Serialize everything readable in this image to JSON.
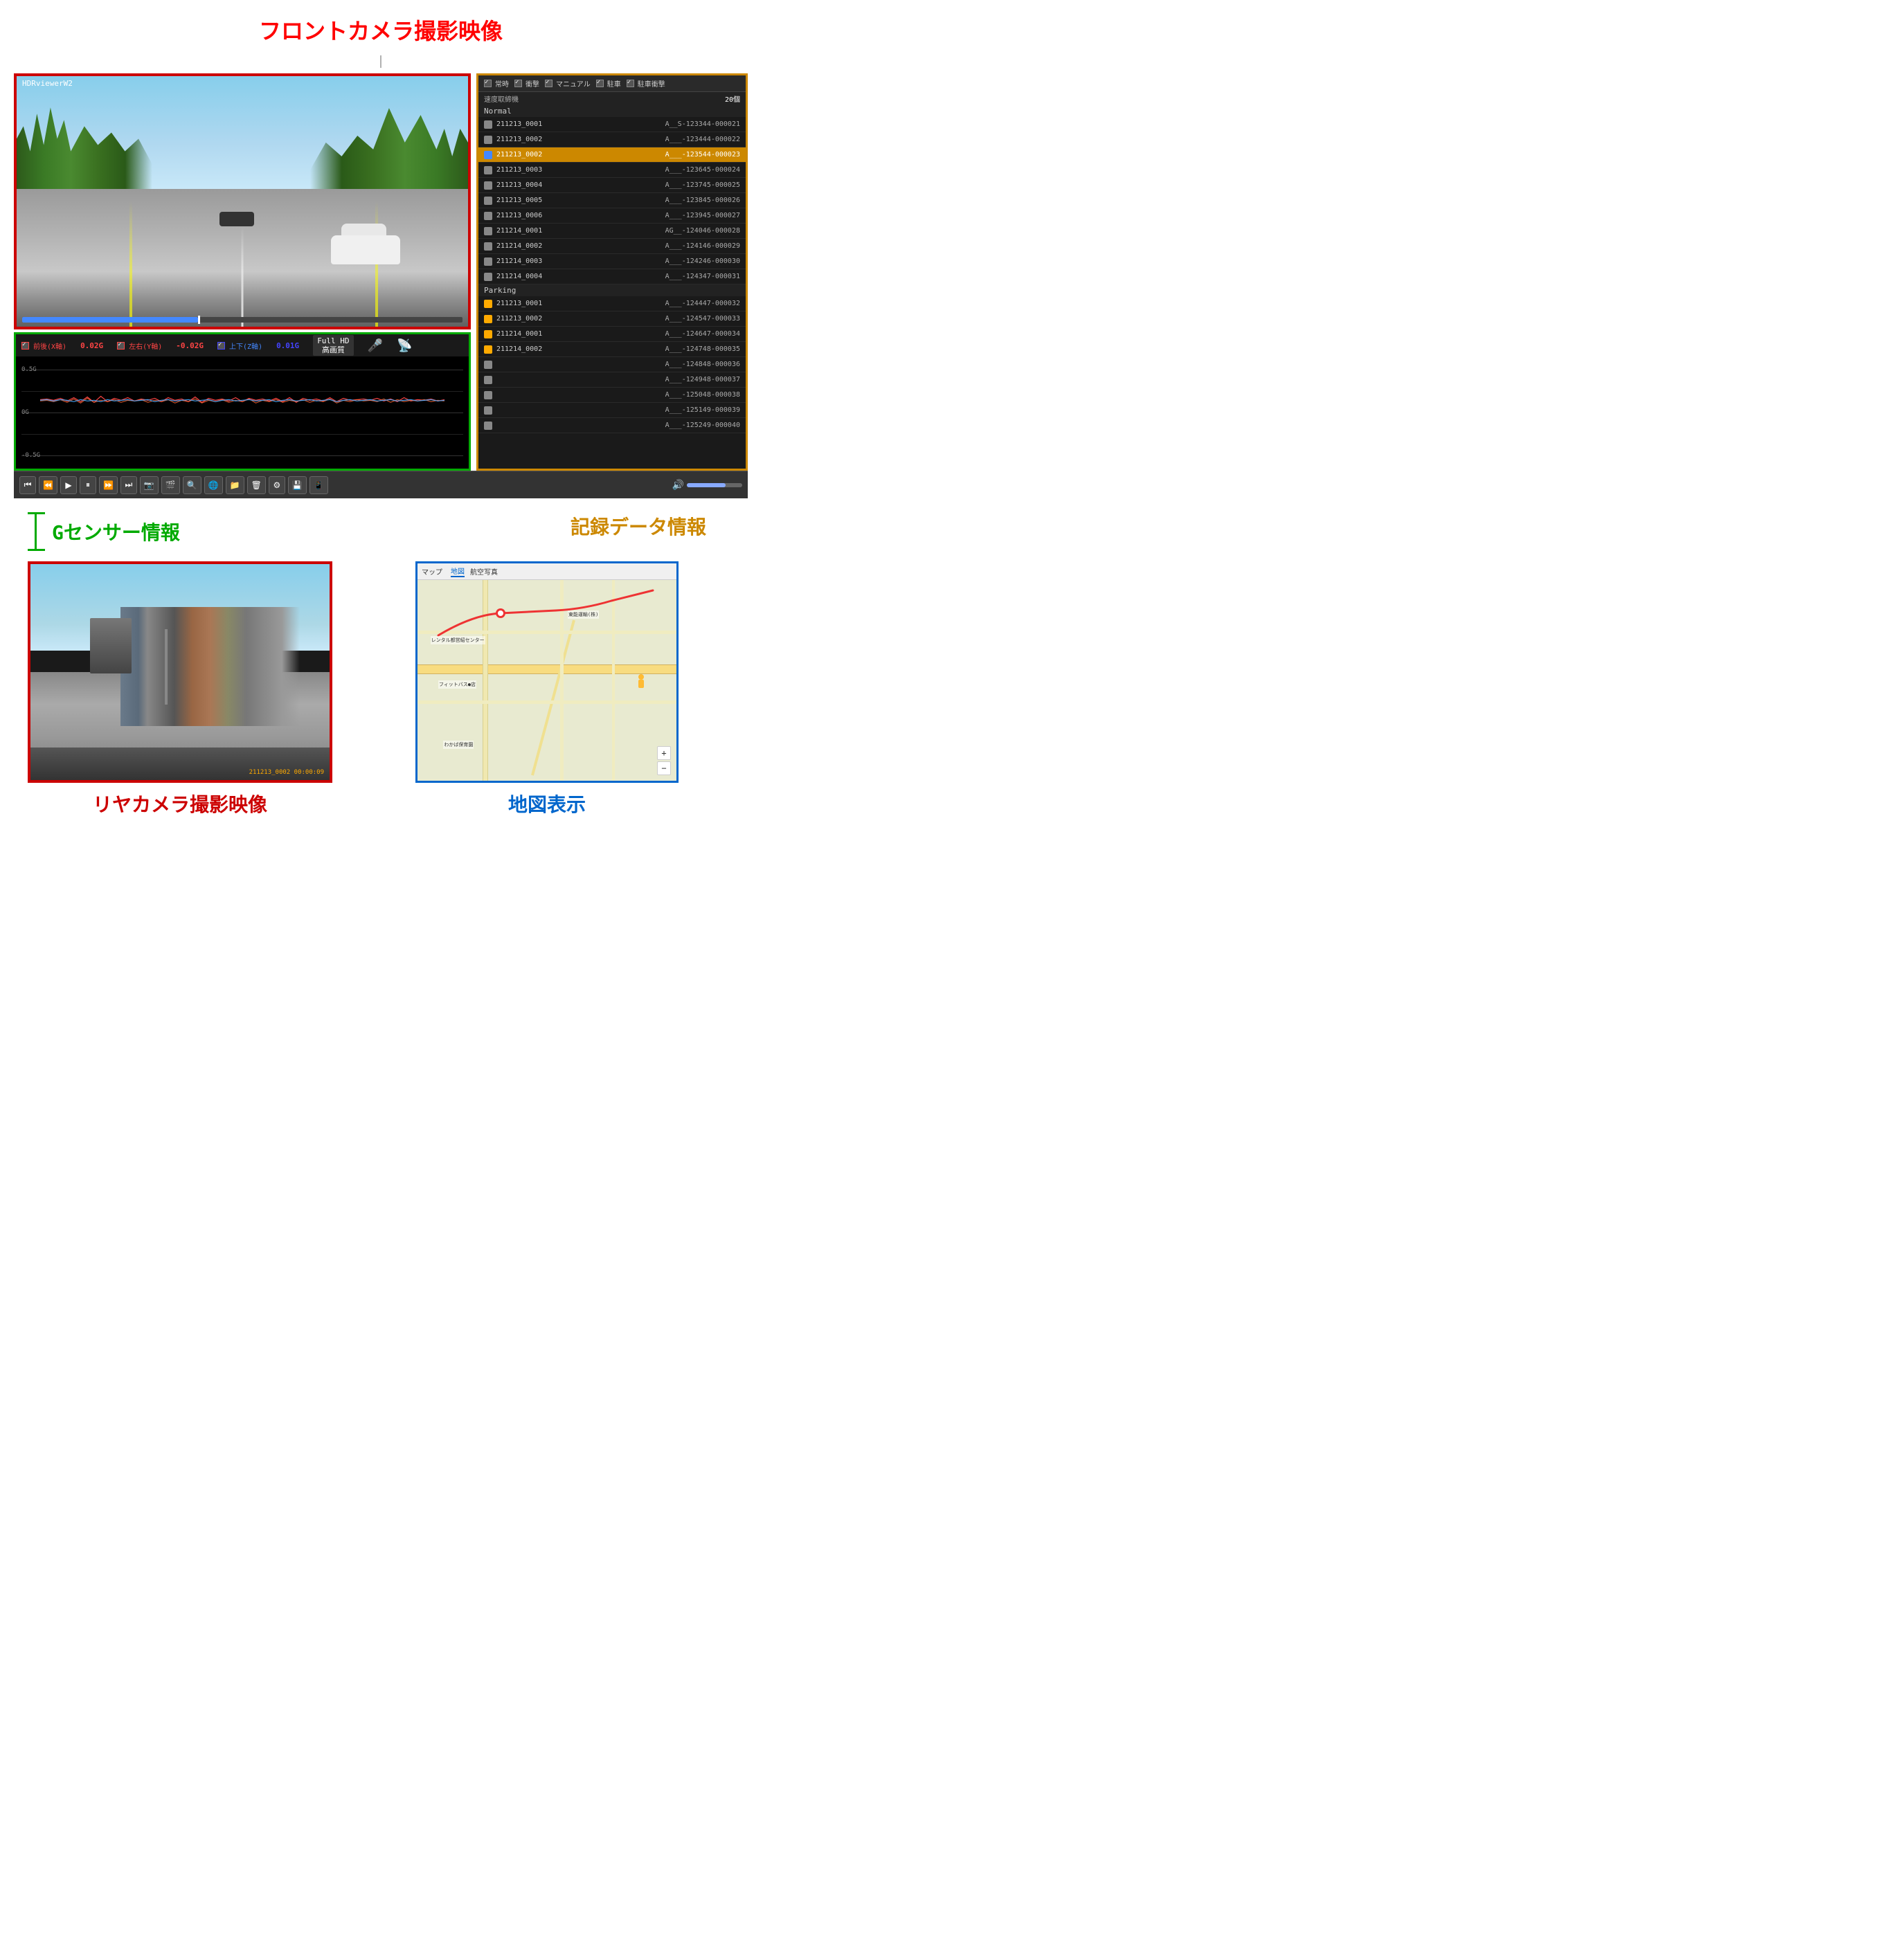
{
  "title": "フロントカメラ撮影映像",
  "viewer": {
    "name": "HDRviewerW2",
    "camera_label": "HDRviewerW2"
  },
  "gsensor": {
    "title": "Gセンサー情報",
    "label_x": "前後(X軸)",
    "label_y": "左右(Y軸)",
    "label_z": "上下(Z軸)",
    "value_x": "0.02G",
    "value_y": "-0.02G",
    "value_z": "0.01G",
    "quality": "Full HD",
    "quality2": "高画質",
    "grid_top": "0.5G",
    "grid_mid": "0G",
    "grid_bot": "-0.5G"
  },
  "data_panel": {
    "title": "記録データ情報",
    "filters": {
      "normal": "✓常時",
      "shock": "✓衝撃",
      "manual": "✓マニュアル",
      "parking": "✓駐車",
      "park_shock": "✓駐車衝撃"
    },
    "subheader": "速度取締機",
    "count": "20個",
    "groups": [
      {
        "label": "Normal",
        "items": [
          {
            "name": "211213_0001",
            "id": "A__S-123344-000021",
            "selected": false,
            "icon": "normal"
          },
          {
            "name": "211213_0002",
            "id": "A___-123444-000022",
            "selected": false,
            "icon": "normal"
          },
          {
            "name": "211213_0002",
            "id": "A___-123544-000023",
            "selected": true,
            "icon": "blue"
          },
          {
            "name": "211213_0003",
            "id": "A___-123645-000024",
            "selected": false,
            "icon": "normal"
          },
          {
            "name": "211213_0004",
            "id": "A___-123745-000025",
            "selected": false,
            "icon": "normal"
          },
          {
            "name": "211213_0005",
            "id": "A___-123845-000026",
            "selected": false,
            "icon": "normal"
          },
          {
            "name": "211213_0006",
            "id": "A___-123945-000027",
            "selected": false,
            "icon": "normal"
          },
          {
            "name": "211214_0001",
            "id": "AG__-124046-000028",
            "selected": false,
            "icon": "normal"
          },
          {
            "name": "211214_0002",
            "id": "A___-124146-000029",
            "selected": false,
            "icon": "normal"
          },
          {
            "name": "211214_0003",
            "id": "A___-124246-000030",
            "selected": false,
            "icon": "normal"
          },
          {
            "name": "211214_0004",
            "id": "A___-124347-000031",
            "selected": false,
            "icon": "normal"
          }
        ]
      },
      {
        "label": "Parking",
        "items": [
          {
            "name": "211213_0001",
            "id": "A___-124447-000032",
            "selected": false,
            "icon": "parking"
          },
          {
            "name": "211213_0002",
            "id": "A___-124547-000033",
            "selected": false,
            "icon": "parking"
          },
          {
            "name": "211214_0001",
            "id": "A___-124647-000034",
            "selected": false,
            "icon": "parking"
          },
          {
            "name": "211214_0002",
            "id": "A___-124748-000035",
            "selected": false,
            "icon": "parking"
          }
        ]
      }
    ],
    "extra_ids": [
      "A___-124848-000036",
      "A___-124948-000037",
      "A___-125048-000038",
      "A___-125149-000039",
      "A___-125249-000040"
    ]
  },
  "toolbar": {
    "buttons": [
      "⏮",
      "⏭",
      "▶",
      "⏸",
      "⏩",
      "⏭",
      "📷",
      "🎬",
      "🔍",
      "🌐",
      "📁",
      "🗑",
      "⚙",
      "💾",
      "📱"
    ]
  },
  "rear_camera": {
    "label": "リヤカメラ撮影映像",
    "timestamp": "211213_0002 00:00:09"
  },
  "map": {
    "label": "地図表示",
    "tabs": [
      "マップ",
      "地図",
      "航空写真"
    ],
    "places": [
      "東能運輸(株)",
      "レンタル都営紹センター",
      "フィットバス●店",
      "わかば保育園"
    ]
  },
  "colors": {
    "red_border": "#cc0000",
    "green_border": "#00aa00",
    "orange_border": "#cc8800",
    "blue_border": "#0066cc",
    "selected_row": "#cc8800",
    "title_red": "#ff0000",
    "gsensor_green": "#00aa00",
    "data_orange": "#cc8800",
    "map_blue": "#0066cc"
  }
}
